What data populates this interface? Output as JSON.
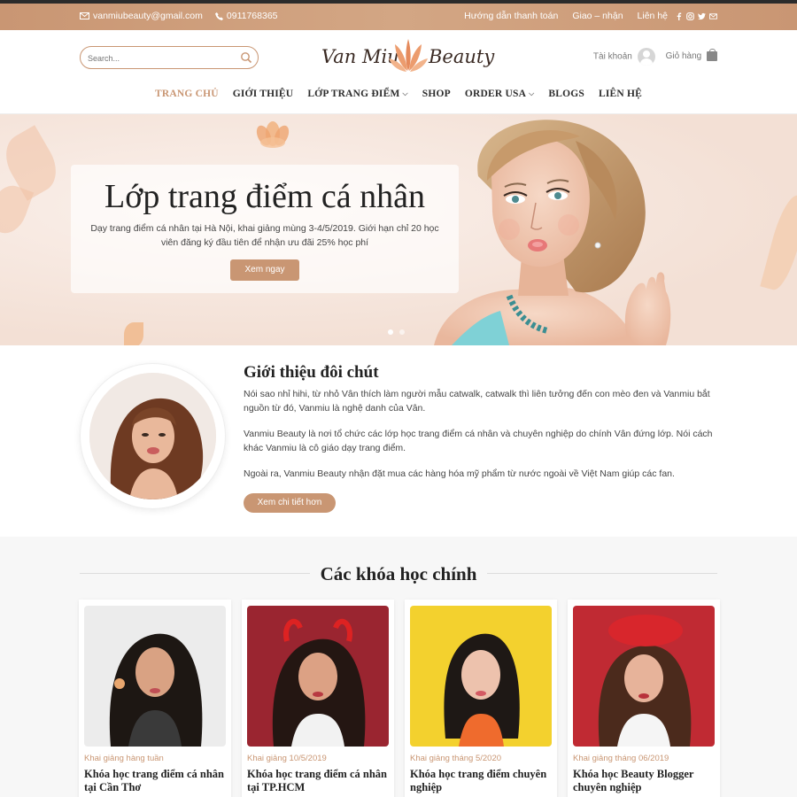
{
  "topbar": {
    "email": "vanmiubeauty@gmail.com",
    "phone": "0911768365",
    "links": [
      "Hướng dẫn thanh toán",
      "Giao – nhận",
      "Liên hệ"
    ]
  },
  "header": {
    "search_placeholder": "Search...",
    "logo_left": "Van Miu",
    "logo_right": "Beauty",
    "account_label": "Tài khoản",
    "cart_label": "Giỏ hàng"
  },
  "nav": {
    "items": [
      {
        "label": "TRANG CHỦ"
      },
      {
        "label": "GIỚI THIỆU"
      },
      {
        "label": "LỚP TRANG ĐIỂM"
      },
      {
        "label": "SHOP"
      },
      {
        "label": "ORDER USA"
      },
      {
        "label": "BLOGS"
      },
      {
        "label": "LIÊN HỆ"
      }
    ]
  },
  "hero": {
    "title": "Lớp trang điểm cá nhân",
    "text": "Dạy trang điểm cá nhân tại Hà Nội, khai giảng mùng 3-4/5/2019. Giới hạn chỉ 20 học viên đăng ký đầu tiên để nhận ưu đãi 25% học phí",
    "button": "Xem ngay"
  },
  "intro": {
    "title": "Giới thiệu đôi chút",
    "p1": "Nói sao nhỉ hihi, từ nhỏ Vân thích làm người mẫu catwalk, catwalk thì liên tưởng đến con mèo đen và Vanmiu bắt nguồn từ đó, Vanmiu là nghệ danh của Vân.",
    "p2": "Vanmiu Beauty là nơi tổ chức các lớp học trang điểm cá nhân và chuyên nghiệp do chính Vân đứng lớp. Nói cách khác Vanmiu là cô giáo dạy trang điểm.",
    "p3": "Ngoài ra, Vanmiu Beauty nhận đặt mua các hàng hóa mỹ phẩm từ nước ngoài về Việt Nam giúp các fan.",
    "button": "Xem chi tiết hơn"
  },
  "courses": {
    "title": "Các khóa học chính",
    "items": [
      {
        "date": "Khai giảng hàng tuần",
        "title": "Khóa học trang điểm cá nhân tại Cần Thơ"
      },
      {
        "date": "Khai giảng 10/5/2019",
        "title": "Khóa học trang điểm cá nhân tại TP.HCM"
      },
      {
        "date": "Khai giảng tháng 5/2020",
        "title": "Khóa học trang điểm chuyên nghiệp"
      },
      {
        "date": "Khai giảng tháng 06/2019",
        "title": "Khóa học Beauty Blogger chuyên nghiệp"
      }
    ]
  },
  "colors": {
    "accent": "#c99673",
    "topbar": "#d3a684",
    "hero_bg": "#f6e8e0"
  }
}
